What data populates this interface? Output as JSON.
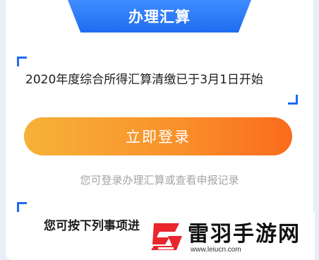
{
  "header": {
    "tab_label": "办理汇算"
  },
  "notice": {
    "text": "2020年度综合所得汇算清缴已于3月1日开始"
  },
  "login_button": {
    "label": "立即登录"
  },
  "hint": {
    "text": "您可登录办理汇算或查看申报记录"
  },
  "items_section": {
    "title": "您可按下列事项进"
  },
  "watermark": {
    "title": "雷羽手游网",
    "url": "www.leiucn.com"
  },
  "colors": {
    "accent_blue": "#1f6cf0",
    "button_orange_start": "#f6b23a",
    "button_orange_end": "#fa6b1d",
    "logo_red": "#e8262c"
  }
}
